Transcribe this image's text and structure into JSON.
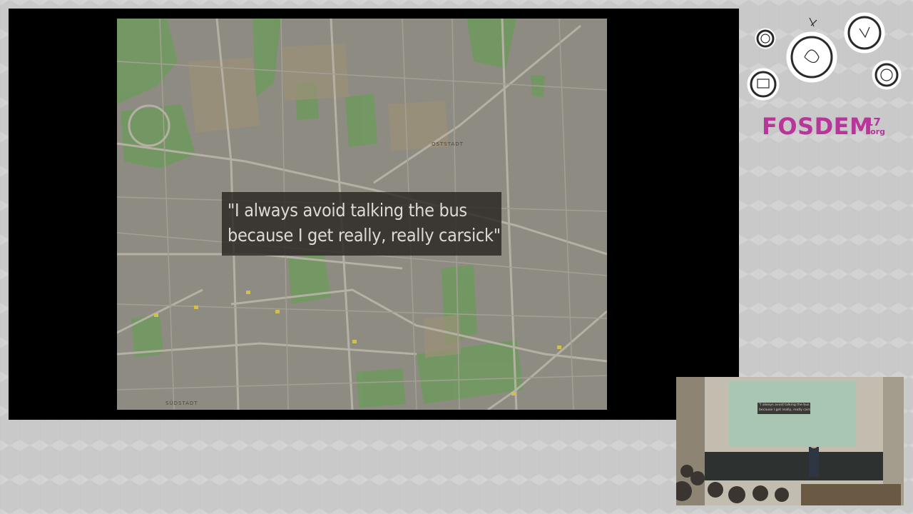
{
  "slide": {
    "caption_line1": "\"I always avoid talking the bus",
    "caption_line2": "because I get really, really carsick\"",
    "map_labels": {
      "district_north": "OSTSTADT",
      "district_south": "SÜDSTADT"
    }
  },
  "branding": {
    "name": "FOSDEM",
    "year": "17",
    "tld": ".org",
    "color": "#b8359a"
  },
  "camera": {
    "caption_line1": "\"I always avoid talking the bus",
    "caption_line2": "because I get really, really carsick\""
  },
  "colors": {
    "map_base": "#8a8780",
    "park_green": "#6f9a5e",
    "background": "#c9c9c9"
  }
}
